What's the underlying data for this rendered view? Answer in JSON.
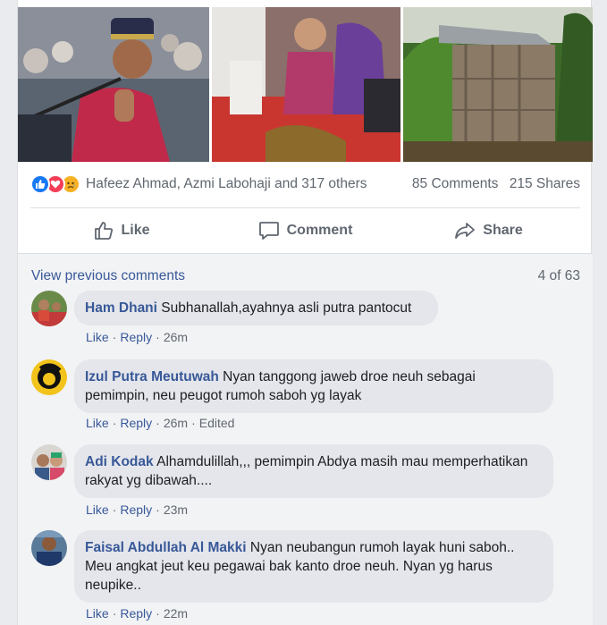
{
  "post": {
    "photos": [
      "man-reciting-quran-photo",
      "family-sitting-photo",
      "wooden-hut-photo"
    ],
    "reactions": {
      "icons": [
        "like-icon",
        "love-icon",
        "sad-icon"
      ],
      "names": "Hafeez Ahmad, Azmi Labohaji and 317 others",
      "comments_count": "85 Comments",
      "shares_count": "215 Shares"
    },
    "actions": {
      "like": "Like",
      "comment": "Comment",
      "share": "Share"
    }
  },
  "comments_section": {
    "view_previous": "View previous comments",
    "page_count": "4 of 63",
    "comments": [
      {
        "author": "Ham Dhani",
        "text": "Subhanallah,ayahnya asli putra pantocut",
        "like": "Like",
        "reply": "Reply",
        "time": "26m",
        "edited": ""
      },
      {
        "author": "Izul Putra Meutuwah",
        "text": "Nyan tanggong jaweb droe neuh sebagai pemimpin, neu peugot rumoh saboh yg layak",
        "like": "Like",
        "reply": "Reply",
        "time": "26m",
        "edited": "Edited"
      },
      {
        "author": "Adi Kodak",
        "text": "Alhamdulillah,,, pemimpin Abdya masih mau memperhatikan rakyat yg dibawah....",
        "like": "Like",
        "reply": "Reply",
        "time": "23m",
        "edited": ""
      },
      {
        "author": "Faisal Abdullah Al Makki",
        "text": "Nyan neubangun rumoh layak huni saboh.. Meu angkat jeut keu pegawai bak kanto droe neuh. Nyan yg harus neupike..",
        "like": "Like",
        "reply": "Reply",
        "time": "22m",
        "edited": ""
      }
    ]
  },
  "colors": {
    "link": "#385898",
    "like_blue": "#1877f2",
    "love_red": "#f33e58",
    "sad_yellow": "#f7b125",
    "bubble": "#e4e6eb"
  }
}
